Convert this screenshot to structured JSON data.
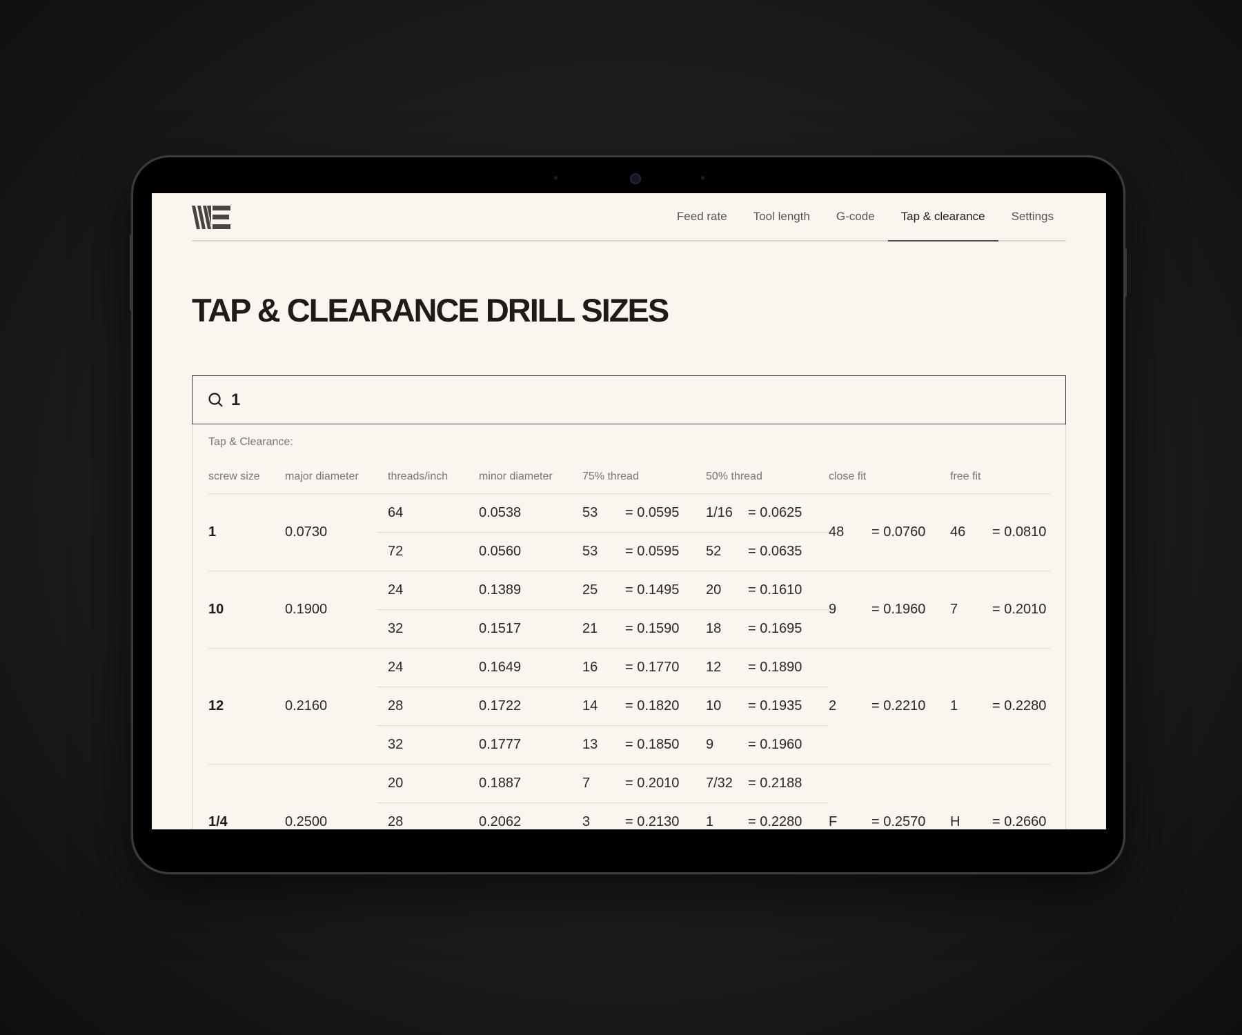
{
  "nav": {
    "items": [
      "Feed rate",
      "Tool length",
      "G-code",
      "Tap & clearance",
      "Settings"
    ],
    "active": "Tap & clearance"
  },
  "page_title": "TAP & CLEARANCE DRILL SIZES",
  "search": {
    "value": "1"
  },
  "table": {
    "caption": "Tap & Clearance:",
    "headers": [
      "screw size",
      "major diameter",
      "threads/inch",
      "minor diameter",
      "75% thread",
      "50% thread",
      "close fit",
      "free fit"
    ],
    "groups": [
      {
        "screw": "1",
        "major": "0.0730",
        "close": [
          "48",
          "= 0.0760"
        ],
        "free": [
          "46",
          "= 0.0810"
        ],
        "rows": [
          {
            "tpi": "64",
            "minor": "0.0538",
            "t75": [
              "53",
              "= 0.0595"
            ],
            "t50": [
              "1/16",
              "= 0.0625"
            ]
          },
          {
            "tpi": "72",
            "minor": "0.0560",
            "t75": [
              "53",
              "= 0.0595"
            ],
            "t50": [
              "52",
              "= 0.0635"
            ]
          }
        ]
      },
      {
        "screw": "10",
        "major": "0.1900",
        "close": [
          "9",
          "= 0.1960"
        ],
        "free": [
          "7",
          "= 0.2010"
        ],
        "rows": [
          {
            "tpi": "24",
            "minor": "0.1389",
            "t75": [
              "25",
              "= 0.1495"
            ],
            "t50": [
              "20",
              "= 0.1610"
            ]
          },
          {
            "tpi": "32",
            "minor": "0.1517",
            "t75": [
              "21",
              "= 0.1590"
            ],
            "t50": [
              "18",
              "= 0.1695"
            ]
          }
        ]
      },
      {
        "screw": "12",
        "major": "0.2160",
        "close": [
          "2",
          "= 0.2210"
        ],
        "free": [
          "1",
          "= 0.2280"
        ],
        "rows": [
          {
            "tpi": "24",
            "minor": "0.1649",
            "t75": [
              "16",
              "= 0.1770"
            ],
            "t50": [
              "12",
              "= 0.1890"
            ]
          },
          {
            "tpi": "28",
            "minor": "0.1722",
            "t75": [
              "14",
              "= 0.1820"
            ],
            "t50": [
              "10",
              "= 0.1935"
            ]
          },
          {
            "tpi": "32",
            "minor": "0.1777",
            "t75": [
              "13",
              "= 0.1850"
            ],
            "t50": [
              "9",
              "= 0.1960"
            ]
          }
        ]
      },
      {
        "screw": "1/4",
        "major": "0.2500",
        "close": [
          "F",
          "= 0.2570"
        ],
        "free": [
          "H",
          "= 0.2660"
        ],
        "rows": [
          {
            "tpi": "20",
            "minor": "0.1887",
            "t75": [
              "7",
              "= 0.2010"
            ],
            "t50": [
              "7/32",
              "= 0.2188"
            ]
          },
          {
            "tpi": "28",
            "minor": "0.2062",
            "t75": [
              "3",
              "= 0.2130"
            ],
            "t50": [
              "1",
              "= 0.2280"
            ]
          }
        ]
      }
    ]
  }
}
